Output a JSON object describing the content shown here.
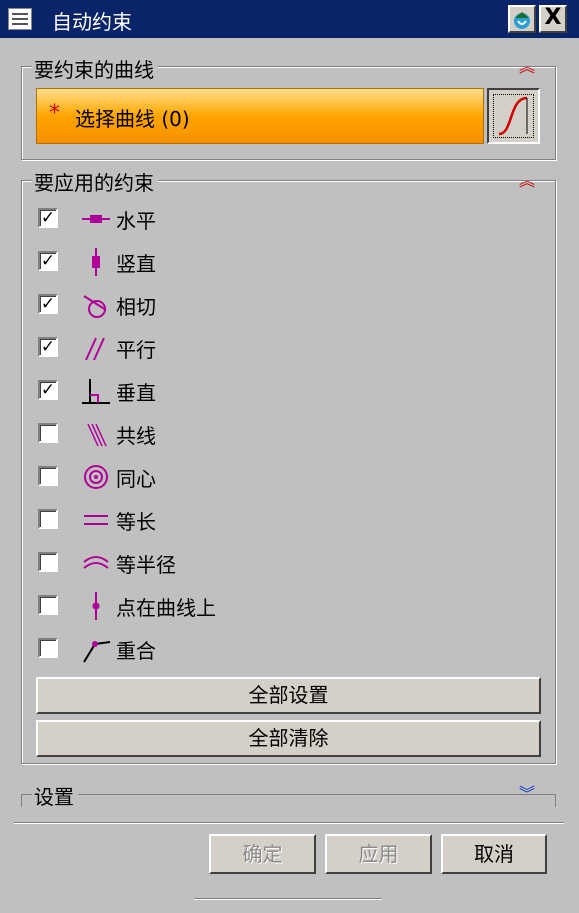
{
  "window": {
    "title": "自动约束",
    "close_label": "X"
  },
  "curves_group": {
    "title": "要约束的曲线",
    "select_star": "*",
    "select_label": "选择曲线 (0)"
  },
  "constraints_group": {
    "title": "要应用的约束",
    "items": [
      {
        "label": "水平",
        "checked": true,
        "icon": "horizontal-icon"
      },
      {
        "label": "竖直",
        "checked": true,
        "icon": "vertical-icon"
      },
      {
        "label": "相切",
        "checked": true,
        "icon": "tangent-icon"
      },
      {
        "label": "平行",
        "checked": true,
        "icon": "parallel-icon"
      },
      {
        "label": "垂直",
        "checked": true,
        "icon": "perpendicular-icon"
      },
      {
        "label": "共线",
        "checked": false,
        "icon": "collinear-icon"
      },
      {
        "label": "同心",
        "checked": false,
        "icon": "concentric-icon"
      },
      {
        "label": "等长",
        "checked": false,
        "icon": "equal-length-icon"
      },
      {
        "label": "等半径",
        "checked": false,
        "icon": "equal-radius-icon"
      },
      {
        "label": "点在曲线上",
        "checked": false,
        "icon": "point-on-curve-icon"
      },
      {
        "label": "重合",
        "checked": false,
        "icon": "coincident-icon"
      }
    ],
    "set_all_label": "全部设置",
    "clear_all_label": "全部清除"
  },
  "settings_group": {
    "title": "设置"
  },
  "footer": {
    "ok_label": "确定",
    "apply_label": "应用",
    "cancel_label": "取消"
  },
  "colors": {
    "accent_purple": "#b0009a",
    "title_bar": "#0a246a",
    "collapse_red": "#cc0000",
    "expand_blue": "#0033cc"
  }
}
